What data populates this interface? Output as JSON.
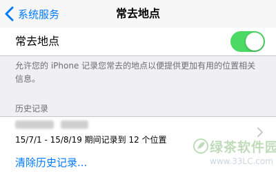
{
  "navbar": {
    "back_label": "系统服务",
    "title": "常去地点"
  },
  "toggle": {
    "label": "常去地点",
    "state": "on",
    "on_color": "#4cd964"
  },
  "description": "允许您的 iPhone 记录您常去的地点以便提供更加有用的位置相关信息。",
  "history": {
    "header": "历史记录",
    "entry": {
      "place": "(blurred)",
      "detail": "15/7/1 - 15/8/19 期间记录到 12 个位置"
    }
  },
  "clear_history_label": "清除历史记录...",
  "watermark": {
    "brand": "绿茶软件园",
    "url": "www.33LC.com"
  },
  "colors": {
    "accent": "#007aff",
    "background": "#efeff4",
    "secondary_text": "#6d6d72"
  }
}
